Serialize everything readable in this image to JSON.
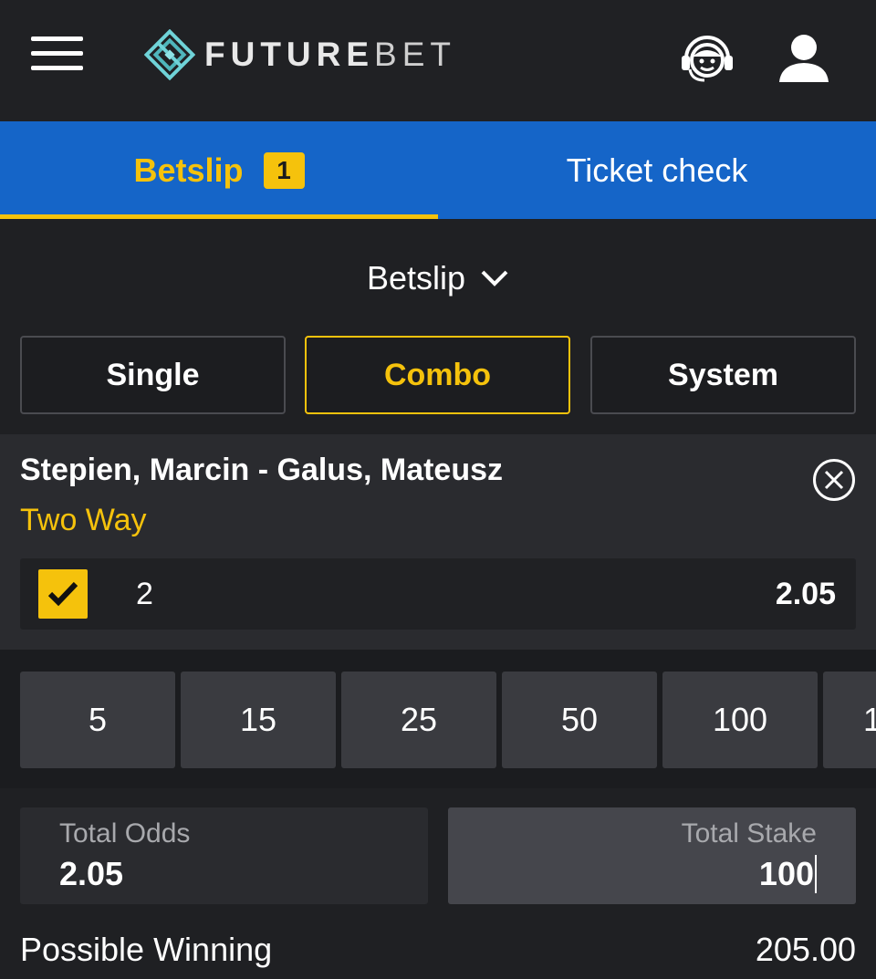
{
  "header": {
    "logo_bold": "FUTURE",
    "logo_light": "BET"
  },
  "tabs": [
    {
      "label": "Betslip",
      "badge": "1",
      "active": true
    },
    {
      "label": "Ticket check",
      "active": false
    }
  ],
  "betslip_dropdown": {
    "label": "Betslip"
  },
  "bet_types": [
    {
      "label": "Single",
      "selected": false
    },
    {
      "label": "Combo",
      "selected": true
    },
    {
      "label": "System",
      "selected": false
    }
  ],
  "selection": {
    "match": "Stepien, Marcin - Galus, Mateusz",
    "market": "Two Way",
    "pick": "2",
    "odds": "2.05",
    "checked": true
  },
  "quick_stakes": [
    "5",
    "15",
    "25",
    "50",
    "100",
    "1"
  ],
  "totals": {
    "odds_label": "Total Odds",
    "odds_value": "2.05",
    "stake_label": "Total Stake",
    "stake_value": "100",
    "winning_label": "Possible Winning",
    "winning_value": "205.00"
  },
  "colors": {
    "accent": "#f5c20c",
    "tab_bar": "#1565c8",
    "background": "#1f2023"
  }
}
